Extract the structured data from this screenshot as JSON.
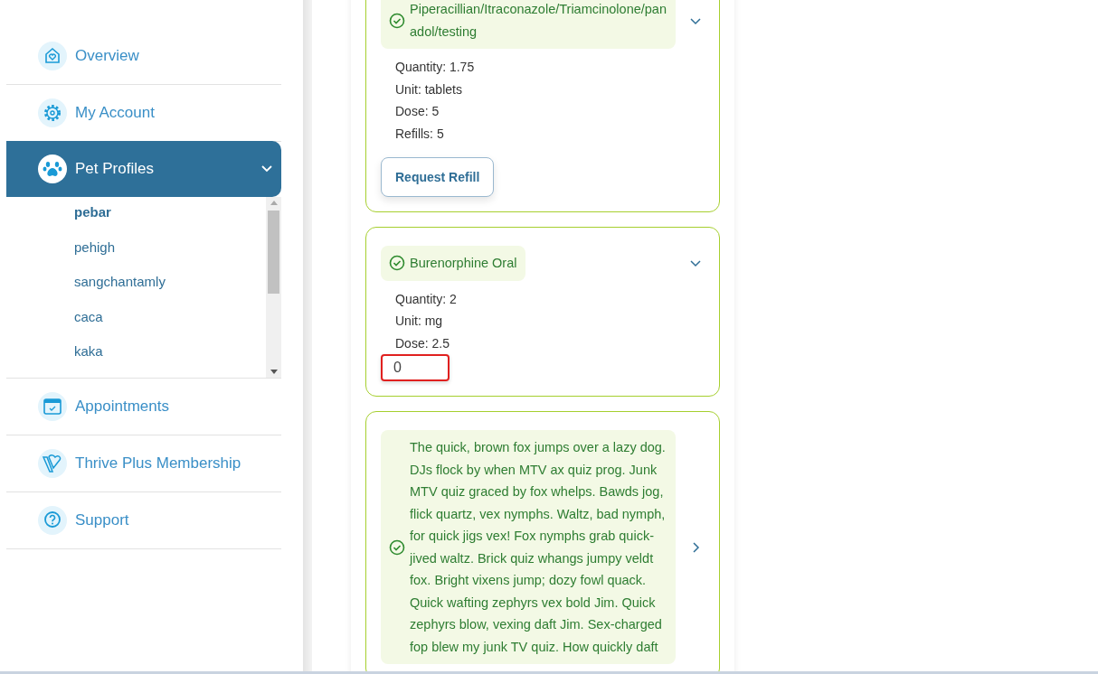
{
  "sidebar": {
    "items": [
      {
        "label": "Overview",
        "kind": "home",
        "selected": false
      },
      {
        "label": "My Account",
        "kind": "gear",
        "selected": false
      },
      {
        "label": "Pet Profiles",
        "kind": "paw",
        "selected": true,
        "expanded": true,
        "children": [
          {
            "label": "pebar",
            "selected": true
          },
          {
            "label": "pehigh",
            "selected": false
          },
          {
            "label": "sangchantamly",
            "selected": false
          },
          {
            "label": "caca",
            "selected": false
          },
          {
            "label": "kaka",
            "selected": false
          }
        ]
      },
      {
        "label": "Appointments",
        "kind": "calendar",
        "selected": false
      },
      {
        "label": "Thrive Plus Membership",
        "kind": "logo",
        "selected": false
      },
      {
        "label": "Support",
        "kind": "help",
        "selected": false
      }
    ]
  },
  "prescriptions": [
    {
      "name": "Piperacillian/Itraconazole/Triamcinolone/panadol/testing",
      "expanded": true,
      "details": [
        "Quantity: 1.75",
        "Unit: tablets",
        "Dose: 5",
        "Refills: 5"
      ],
      "button": "Request Refill"
    },
    {
      "name": "Burenorphine Oral",
      "expanded": true,
      "details": [
        "Quantity: 2",
        "Unit: mg",
        "Dose: 2.5"
      ],
      "refills_input": {
        "value": "0",
        "error": true
      }
    },
    {
      "name": "The quick, brown fox jumps over a lazy dog. DJs flock by when MTV ax quiz prog. Junk MTV quiz graced by fox whelps. Bawds jog, flick quartz, vex nymphs. Waltz, bad nymph, for quick jigs vex! Fox nymphs grab quick-jived waltz. Brick quiz whangs jumpy veldt fox. Bright vixens jump; dozy fowl quack. Quick wafting zephyrs vex bold Jim. Quick zephyrs blow, vexing daft Jim. Sex-charged fop blew my junk TV quiz. How quickly daft",
      "expanded": false
    }
  ]
}
